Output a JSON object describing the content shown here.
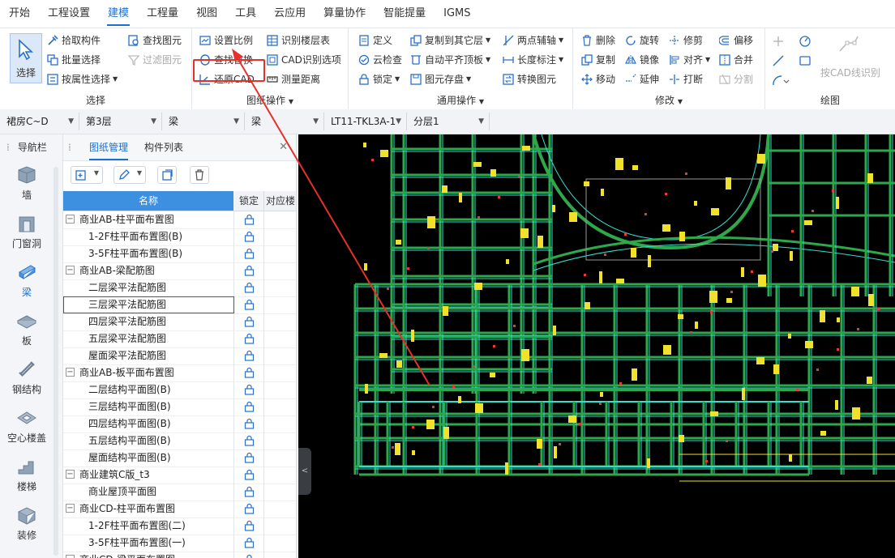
{
  "menubar": {
    "items": [
      {
        "label": "开始",
        "active": false
      },
      {
        "label": "工程设置",
        "active": false
      },
      {
        "label": "建模",
        "active": true
      },
      {
        "label": "工程量",
        "active": false
      },
      {
        "label": "视图",
        "active": false
      },
      {
        "label": "工具",
        "active": false
      },
      {
        "label": "云应用",
        "active": false
      },
      {
        "label": "算量协作",
        "active": false
      },
      {
        "label": "智能提量",
        "active": false
      },
      {
        "label": "IGMS",
        "active": false
      }
    ]
  },
  "ribbon": {
    "select_group": {
      "label": "选择",
      "select_button": "选择",
      "pick": "拾取构件",
      "batch": "批量选择",
      "by_attr": "按属性选择",
      "find": "查找图元",
      "filter": "过滤图元"
    },
    "drawing_group": {
      "label": "图纸操作",
      "set_scale": "设置比例",
      "recognize_floors": "识别楼层表",
      "find_replace": "查找替换",
      "cad_options": "CAD识别选项",
      "restore_cad": "还原CAD",
      "measure": "测量距离"
    },
    "common_group": {
      "label": "通用操作",
      "define": "定义",
      "copy_other_floor": "复制到其它层",
      "two_point_axis": "两点辅轴",
      "cloud_check": "云检查",
      "auto_flat_top": "自动平齐顶板",
      "length_mark": "长度标注",
      "lock": "锁定",
      "save_elem": "图元存盘",
      "convert_elem": "转换图元"
    },
    "modify_group": {
      "label": "修改",
      "delete": "删除",
      "rotate": "旋转",
      "trim": "修剪",
      "offset": "偏移",
      "copy": "复制",
      "mirror": "镜像",
      "align": "对齐",
      "merge": "合并",
      "move": "移动",
      "extend": "延伸",
      "break": "打断",
      "split": "分割"
    },
    "draw_group": {
      "label": "绘图",
      "cad_line_recog": "按CAD线识别"
    }
  },
  "selectors": [
    {
      "value": "裙房C~D"
    },
    {
      "value": "第3层"
    },
    {
      "value": "梁"
    },
    {
      "value": "梁"
    },
    {
      "value": "LT11-TKL3A-1"
    },
    {
      "value": "分层1"
    }
  ],
  "leftnav": {
    "title": "导航栏",
    "items": [
      {
        "label": "墙",
        "icon": "wall-icon"
      },
      {
        "label": "门窗洞",
        "icon": "door-window-icon"
      },
      {
        "label": "梁",
        "icon": "beam-icon"
      },
      {
        "label": "板",
        "icon": "slab-icon"
      },
      {
        "label": "钢结构",
        "icon": "steel-icon"
      },
      {
        "label": "空心楼盖",
        "icon": "hollow-floor-icon"
      },
      {
        "label": "楼梯",
        "icon": "stair-icon"
      },
      {
        "label": "装修",
        "icon": "decoration-icon"
      }
    ]
  },
  "panel": {
    "tabs": [
      "图纸管理",
      "构件列表"
    ],
    "columns": {
      "name": "名称",
      "lock": "锁定",
      "floor": "对应楼"
    },
    "rows": [
      {
        "name": "商业AB-柱平面布置图",
        "level": 0
      },
      {
        "name": "1-2F柱平面布置图(B)",
        "level": 1
      },
      {
        "name": "3-5F柱平面布置图(B)",
        "level": 1
      },
      {
        "name": "商业AB-梁配筋图",
        "level": 0
      },
      {
        "name": "二层梁平法配筋图",
        "level": 1
      },
      {
        "name": "三层梁平法配筋图",
        "level": 1,
        "selected": true
      },
      {
        "name": "四层梁平法配筋图",
        "level": 1
      },
      {
        "name": "五层梁平法配筋图",
        "level": 1
      },
      {
        "name": "屋面梁平法配筋图",
        "level": 1
      },
      {
        "name": "商业AB-板平面布置图",
        "level": 0
      },
      {
        "name": "二层结构平面图(B)",
        "level": 1
      },
      {
        "name": "三层结构平面图(B)",
        "level": 1
      },
      {
        "name": "四层结构平面图(B)",
        "level": 1
      },
      {
        "name": "五层结构平面图(B)",
        "level": 1
      },
      {
        "name": "屋面结构平面图(B)",
        "level": 1
      },
      {
        "name": "商业建筑C版_t3",
        "level": 0
      },
      {
        "name": "商业屋顶平面图",
        "level": 1
      },
      {
        "name": "商业CD-柱平面布置图",
        "level": 0
      },
      {
        "name": "1-2F柱平面布置图(二)",
        "level": 1
      },
      {
        "name": "3-5F柱平面布置图(一)",
        "level": 1
      },
      {
        "name": "商业CD-梁平面布置图",
        "level": 0
      }
    ]
  },
  "colors": {
    "accent": "#1a6fd3",
    "highlight": "#e5312a",
    "cad_green": "#2ea84a",
    "cad_cyan": "#32e0d0",
    "cad_yellow": "#f2e12a"
  }
}
